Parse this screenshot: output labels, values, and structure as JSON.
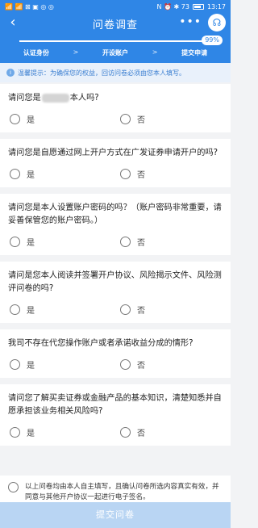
{
  "status_bar": {
    "left_text": "📶 📶 ⊠ ▣ ◎ ◎",
    "right_text": "N ⏰ ✱ 73",
    "time": "13:17"
  },
  "nav": {
    "title": "问卷调查",
    "more": "•••"
  },
  "progress": {
    "percent_label": "99%",
    "value": 0.99,
    "steps": [
      "认证身份",
      "开设账户",
      "提交申请"
    ],
    "arrow": ">"
  },
  "notice": {
    "text": "温馨提示：为确保您的权益，回访问卷必须由您本人填写。"
  },
  "questions": [
    {
      "prefix": "请问您是",
      "suffix": "本人吗?",
      "yes": "是",
      "no": "否"
    },
    {
      "text": "请问您是自愿通过网上开户方式在广发证券申请开户的吗?",
      "yes": "是",
      "no": "否"
    },
    {
      "text": "请问您是本人设置账户密码的吗？（账户密码非常重要，请妥善保管您的账户密码。）",
      "yes": "是",
      "no": "否"
    },
    {
      "text": "请问是您本人阅读并签署开户协议、风险揭示文件、风险测评问卷的吗?",
      "yes": "是",
      "no": "否"
    },
    {
      "text": "我司不存在代您操作账户或者承诺收益分成的情形?",
      "yes": "是",
      "no": "否"
    },
    {
      "text": "请问您了解买卖证券或金融产品的基本知识，清楚知悉并自愿承担该业务相关风险吗?",
      "yes": "是",
      "no": "否"
    }
  ],
  "confirm": {
    "text": "以上问卷均由本人自主填写，且确认问卷所选内容真实有效，并同意与其他开户协议一起进行电子签名。"
  },
  "submit_label": "提交问卷",
  "colors": {
    "header": "#2f86e6",
    "submit_disabled": "#b9d5f3"
  }
}
